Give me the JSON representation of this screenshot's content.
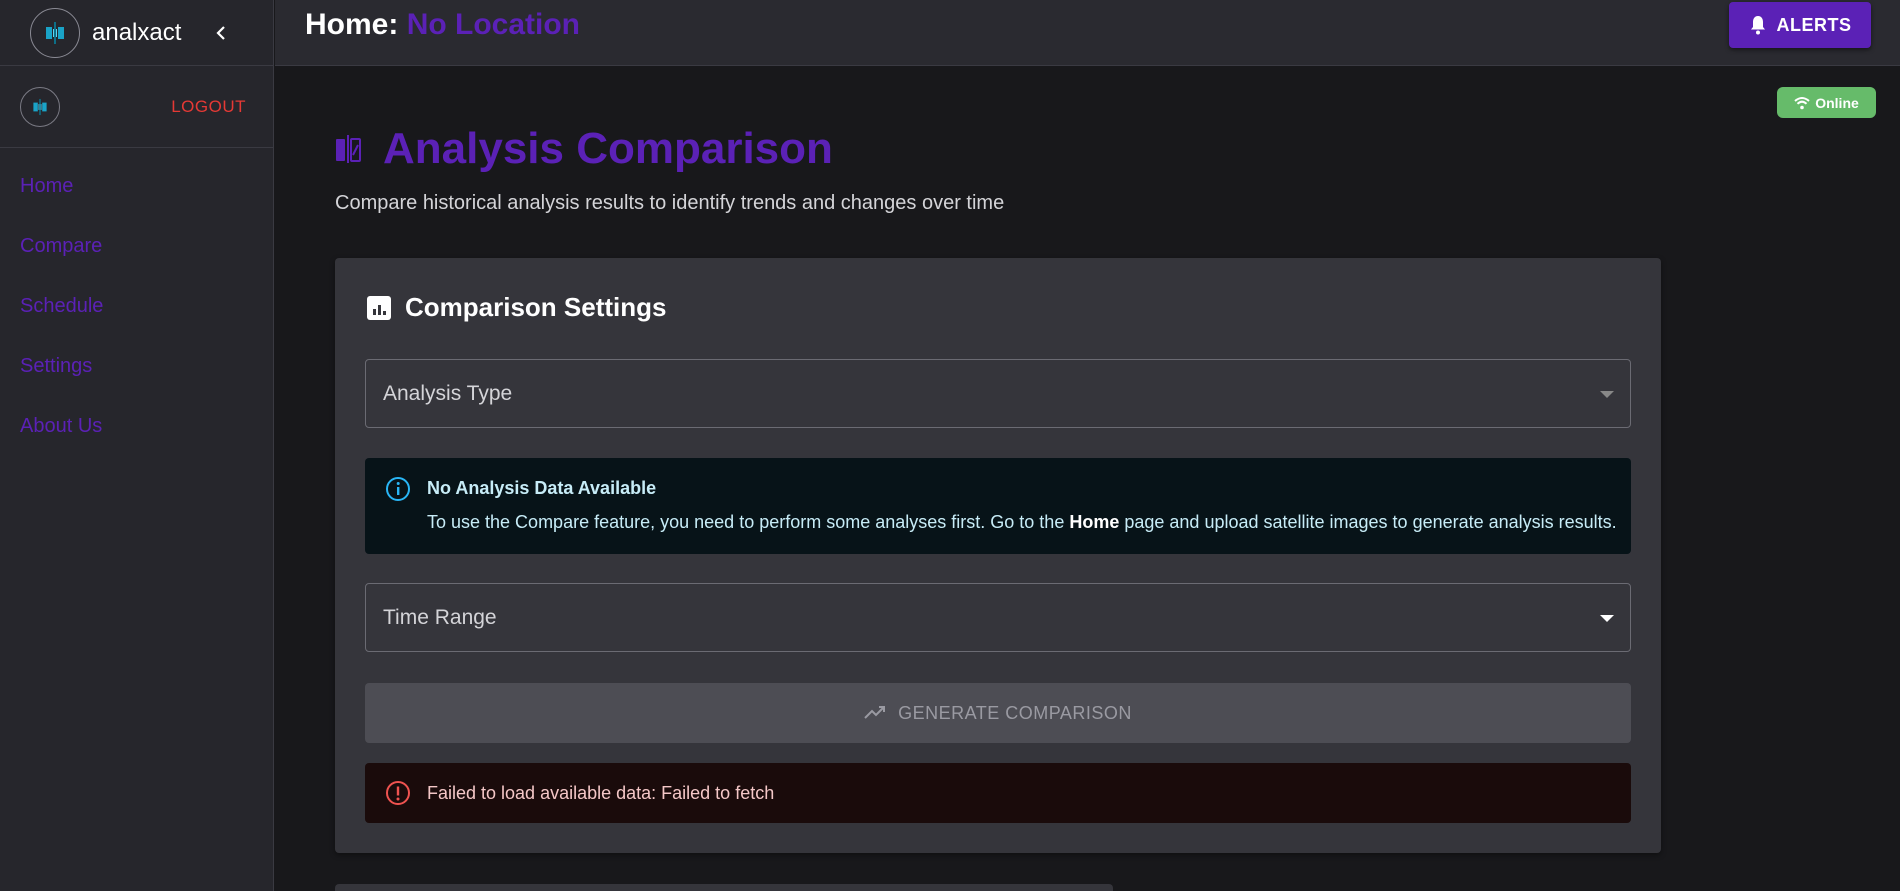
{
  "app": {
    "name": "analxact"
  },
  "sidebar": {
    "logout_label": "LOGOUT",
    "items": [
      {
        "label": "Home"
      },
      {
        "label": "Compare"
      },
      {
        "label": "Schedule"
      },
      {
        "label": "Settings"
      },
      {
        "label": "About Us"
      }
    ]
  },
  "topbar": {
    "title_prefix": "Home: ",
    "location": "No Location",
    "alerts_label": "ALERTS"
  },
  "status": {
    "online_label": "Online"
  },
  "page": {
    "title": "Analysis Comparison",
    "subtitle": "Compare historical analysis results to identify trends and changes over time"
  },
  "settings_card": {
    "title": "Comparison Settings",
    "analysis_type_label": "Analysis Type",
    "info": {
      "title": "No Analysis Data Available",
      "text_before": "To use the Compare feature, you need to perform some analyses first. Go to the ",
      "text_bold": "Home",
      "text_after": " page and upload satellite images to generate analysis results."
    },
    "time_range_label": "Time Range",
    "generate_label": "GENERATE COMPARISON",
    "error_text": "Failed to load available data: Failed to fetch"
  },
  "colors": {
    "accent": "#5b21b6",
    "logout": "#e53935",
    "online": "#66bb6a",
    "info_bg": "#071318",
    "error_bg": "#1a0b0b"
  }
}
